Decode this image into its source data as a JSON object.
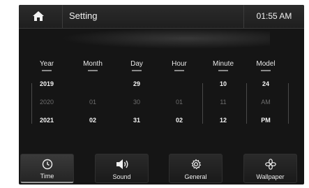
{
  "header": {
    "title": "Setting",
    "time": "01:55 AM"
  },
  "columns": [
    {
      "head": "Year",
      "top": "2019",
      "mid": "2020",
      "bot": "2021"
    },
    {
      "head": "Month",
      "top": "",
      "mid": "01",
      "bot": "02"
    },
    {
      "head": "Day",
      "top": "29",
      "mid": "30",
      "bot": "31"
    },
    {
      "head": "Hour",
      "top": "",
      "mid": "01",
      "bot": "02"
    },
    {
      "head": "Minute",
      "top": "10",
      "mid": "11",
      "bot": "12"
    },
    {
      "head": "Model",
      "top": "24",
      "mid": "AM",
      "bot": "PM"
    }
  ],
  "tabs": [
    {
      "label": "Time",
      "icon": "clock-icon"
    },
    {
      "label": "Sound",
      "icon": "speaker-icon"
    },
    {
      "label": "General",
      "icon": "gear-icon"
    },
    {
      "label": "Wallpaper",
      "icon": "flower-icon"
    }
  ],
  "colors": {
    "panel": "#151515",
    "text": "#e8e8e8",
    "dimmed": "#6e6e6e"
  }
}
